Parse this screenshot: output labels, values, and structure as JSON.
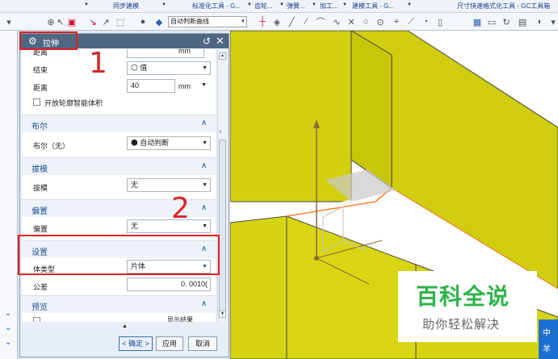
{
  "menubar": {
    "items": [
      "同步建模",
      "标准化工具 - G...",
      "齿轮...",
      "弹簧...",
      "加工...",
      "建模工具 - G...",
      "尺寸快速格式化工具 - GC工具箱"
    ]
  },
  "toolbar": {
    "filter_value": "自动判断曲线"
  },
  "dialog": {
    "title": "拉伸",
    "top_rows": {
      "distance_top_label": "距离",
      "distance_top_unit": "mm",
      "end_label": "结束",
      "end_value": "值",
      "distance_label": "距离",
      "distance_value": "40",
      "distance_unit": "mm",
      "open_profile_label": "开放轮廓智能体积"
    },
    "sections": {
      "boolean": {
        "title": "布尔",
        "row_label": "布尔（无）",
        "row_value": "自动判断"
      },
      "draft": {
        "title": "拔模",
        "row_label": "拔模",
        "row_value": "无"
      },
      "offset": {
        "title": "偏置",
        "row_label": "偏置",
        "row_value": "无"
      },
      "settings": {
        "title": "设置",
        "body_type_label": "体类型",
        "body_type_value": "片体",
        "tolerance_label": "公差",
        "tolerance_value": "0. 0010("
      },
      "preview": {
        "title": "预览",
        "show_result_label": "显示结果"
      }
    },
    "buttons": {
      "ok": "< 确定 >",
      "apply": "应用",
      "cancel": "取消"
    }
  },
  "annotations": {
    "step1": "1",
    "step2": "2"
  },
  "watermark": {
    "big": "百科全说",
    "small": "助你轻松解决"
  },
  "badge": {
    "line1": "中",
    "line2": "羊"
  },
  "colors": {
    "model_face": "#d6d410",
    "accent_title": "#4f6783",
    "highlight": "#e02020"
  }
}
